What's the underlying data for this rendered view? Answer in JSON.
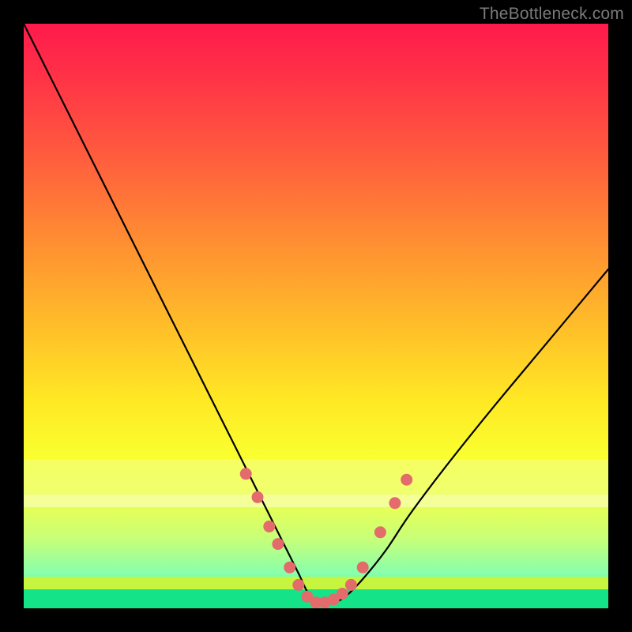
{
  "watermark": "TheBottleneck.com",
  "chart_data": {
    "type": "line",
    "title": "",
    "xlabel": "",
    "ylabel": "",
    "xlim": [
      0,
      100
    ],
    "ylim": [
      0,
      100
    ],
    "grid": false,
    "legend": false,
    "series": [
      {
        "name": "bottleneck-curve",
        "x": [
          0,
          4,
          8,
          12,
          16,
          20,
          24,
          28,
          32,
          36,
          40,
          44,
          47,
          49,
          51,
          53,
          55,
          58,
          62,
          66,
          72,
          80,
          90,
          100
        ],
        "y": [
          100,
          92,
          84,
          76,
          68,
          60,
          52,
          44,
          36,
          28,
          20,
          12,
          6,
          2,
          1,
          1,
          2,
          5,
          10,
          16,
          24,
          34,
          46,
          58
        ]
      }
    ],
    "markers": {
      "name": "highlight-points",
      "color": "#e46b6b",
      "x": [
        38,
        40,
        42,
        43.5,
        45.5,
        47,
        48.5,
        50,
        51.5,
        53,
        54.5,
        56,
        58,
        61,
        63.5,
        65.5
      ],
      "y": [
        23,
        19,
        14,
        11,
        7,
        4,
        2,
        1,
        1,
        1.5,
        2.5,
        4,
        7,
        13,
        18,
        22
      ]
    },
    "background_gradient_stops": [
      {
        "pos": 0,
        "color": "#ff1a4b"
      },
      {
        "pos": 0.5,
        "color": "#ffe724"
      },
      {
        "pos": 1,
        "color": "#29f59c"
      }
    ]
  }
}
